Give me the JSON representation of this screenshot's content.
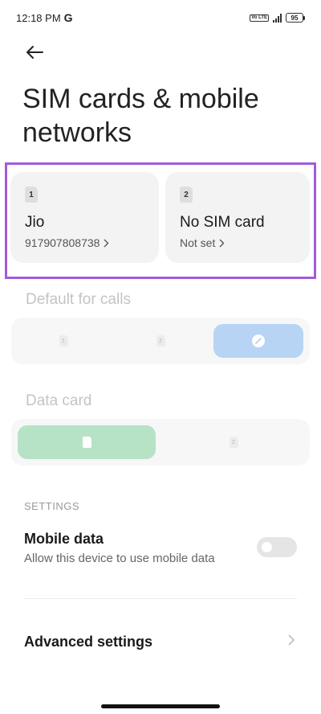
{
  "status_bar": {
    "time": "12:18 PM",
    "google_letter": "G",
    "volte_label": "Vo LTE",
    "battery": "95"
  },
  "header": {
    "title": "SIM cards & mobile networks"
  },
  "sim_cards": [
    {
      "slot": "1",
      "name": "Jio",
      "subtitle": "917907808738"
    },
    {
      "slot": "2",
      "name": "No SIM card",
      "subtitle": "Not set"
    }
  ],
  "default_calls": {
    "label": "Default for calls",
    "options": [
      "1",
      "2"
    ],
    "selected": "ask-every-time",
    "selected_color": "#b7d4f4"
  },
  "data_card": {
    "label": "Data card",
    "options": [
      "1",
      "2"
    ],
    "selected": "1",
    "selected_color": "#b6e2c6"
  },
  "settings": {
    "header": "SETTINGS",
    "mobile_data": {
      "title": "Mobile data",
      "subtitle": "Allow this device to use mobile data",
      "enabled": false
    },
    "advanced": {
      "title": "Advanced settings"
    }
  },
  "colors": {
    "highlight": "#a25bdb",
    "card_bg": "#f3f3f3"
  },
  "icons": [
    "back-arrow-icon",
    "chevron-right-icon",
    "edit-pen-icon",
    "sim-badge-icon"
  ]
}
